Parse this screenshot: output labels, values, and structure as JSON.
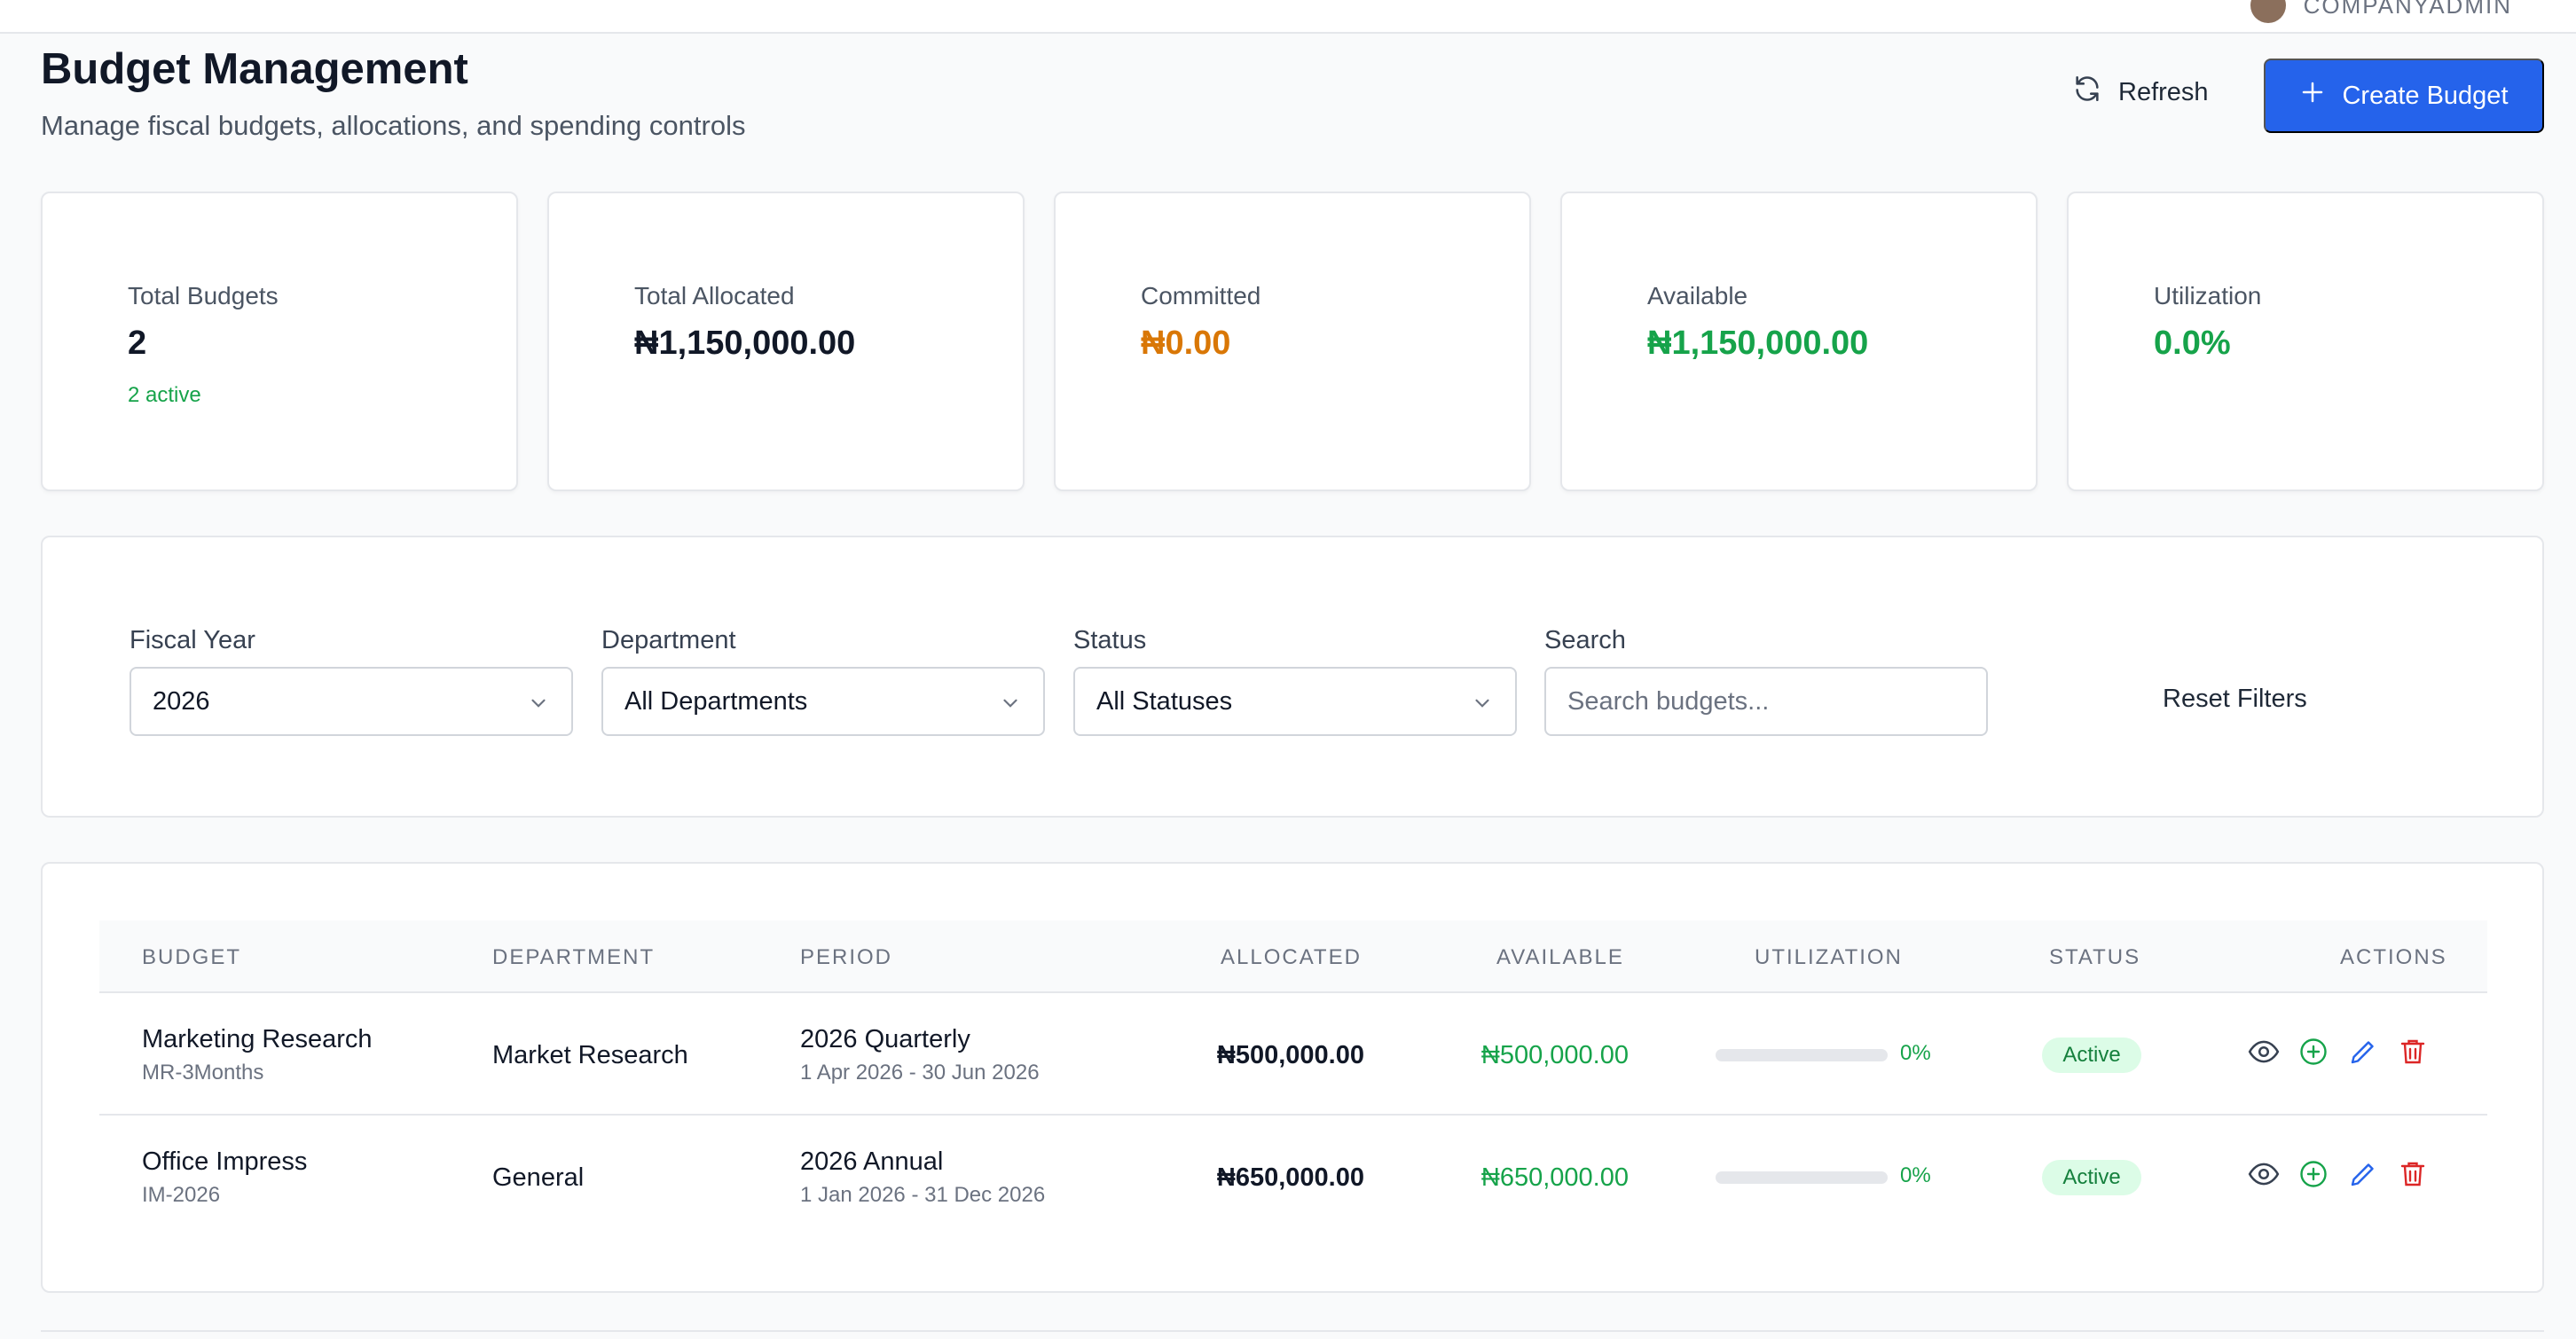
{
  "topbar": {
    "user_label": "COMPANYADMIN"
  },
  "header": {
    "title": "Budget Management",
    "subtitle": "Manage fiscal budgets, allocations, and spending controls",
    "refresh_label": "Refresh",
    "create_label": "Create Budget"
  },
  "stats": [
    {
      "label": "Total Budgets",
      "value": "2",
      "note": "2 active",
      "color": "#111827"
    },
    {
      "label": "Total Allocated",
      "value": "₦1,150,000.00",
      "color": "#111827"
    },
    {
      "label": "Committed",
      "value": "₦0.00",
      "color": "#d97706"
    },
    {
      "label": "Available",
      "value": "₦1,150,000.00",
      "color": "#16a34a"
    },
    {
      "label": "Utilization",
      "value": "0.0%",
      "color": "#16a34a"
    }
  ],
  "filters": {
    "fiscal_year": {
      "label": "Fiscal Year",
      "value": "2026"
    },
    "department": {
      "label": "Department",
      "value": "All Departments"
    },
    "status": {
      "label": "Status",
      "value": "All Statuses"
    },
    "search": {
      "label": "Search",
      "placeholder": "Search budgets..."
    },
    "reset_label": "Reset Filters"
  },
  "table": {
    "columns": [
      "BUDGET",
      "DEPARTMENT",
      "PERIOD",
      "ALLOCATED",
      "AVAILABLE",
      "UTILIZATION",
      "STATUS",
      "ACTIONS"
    ],
    "rows": [
      {
        "name": "Marketing Research",
        "code": "MR-3Months",
        "department": "Market Research",
        "period": "2026 Quarterly",
        "period_range": "1 Apr 2026 - 30 Jun 2026",
        "allocated": "₦500,000.00",
        "available": "₦500,000.00",
        "utilization": 0,
        "utilization_label": "0%",
        "status": "Active"
      },
      {
        "name": "Office Impress",
        "code": "IM-2026",
        "department": "General",
        "period": "2026 Annual",
        "period_range": "1 Jan 2026 - 31 Dec 2026",
        "allocated": "₦650,000.00",
        "available": "₦650,000.00",
        "utilization": 0,
        "utilization_label": "0%",
        "status": "Active"
      }
    ]
  },
  "colors": {
    "primary": "#2563eb",
    "success": "#16a34a",
    "warning": "#d97706",
    "danger": "#dc2626"
  },
  "icons": [
    "refresh-icon",
    "plus-icon",
    "chevron-down-icon",
    "eye-icon",
    "plus-circle-icon",
    "pencil-icon",
    "trash-icon"
  ]
}
